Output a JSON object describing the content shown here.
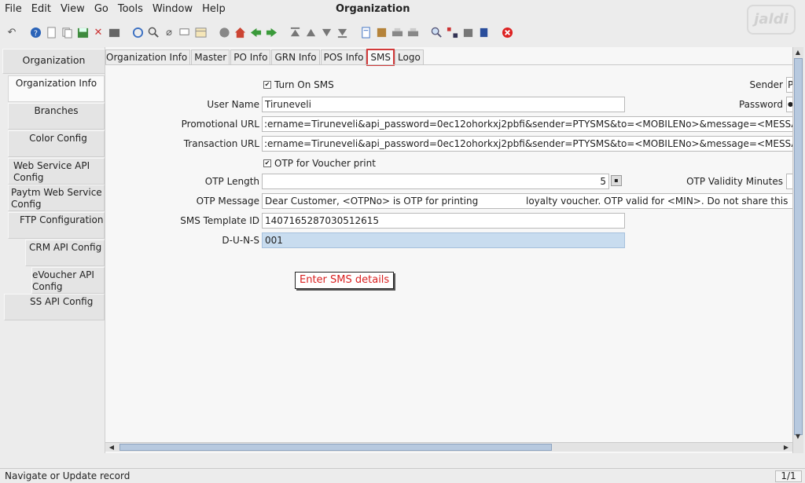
{
  "menu": {
    "file": "File",
    "edit": "Edit",
    "view": "View",
    "go": "Go",
    "tools": "Tools",
    "window": "Window",
    "help": "Help"
  },
  "window_title": "Organization",
  "brand": "jaldi",
  "icons": [
    "undo-icon",
    "help-icon",
    "new-icon",
    "copy-icon",
    "save-icon",
    "delete-icon",
    "print-icon",
    "refresh-icon",
    "zoom-icon",
    "attachment-icon",
    "chat-icon",
    "history-icon",
    "home-icon",
    "back-icon",
    "forward-icon",
    "first-icon",
    "prev-icon",
    "next-icon",
    "last-icon",
    "report-icon",
    "archive-icon",
    "print-preview-icon",
    "print-icon",
    "lookup-icon",
    "workflow-icon",
    "request-icon",
    "product-icon",
    "close-icon"
  ],
  "sidebar": {
    "items": [
      {
        "label": "Organization"
      },
      {
        "label": "Organization Info"
      },
      {
        "label": "Branches"
      },
      {
        "label": "Color Config"
      },
      {
        "label": "Web Service API Config"
      },
      {
        "label": "Paytm Web Service Config"
      },
      {
        "label": "FTP Configuration"
      },
      {
        "label": "CRM API Config"
      },
      {
        "label": "eVoucher API Config"
      },
      {
        "label": "SS API Config"
      }
    ]
  },
  "tabs": [
    "Organization Info",
    "Master",
    "PO Info",
    "GRN Info",
    "POS Info",
    "SMS",
    "Logo"
  ],
  "form": {
    "turn_on_sms": "Turn On SMS",
    "sender_label": "Sender",
    "sender_value": "P",
    "user_name_label": "User Name",
    "user_name_value": "Tiruneveli",
    "password_label": "Password",
    "password_value": "●",
    "promo_url_label": "Promotional URL",
    "promo_url_value": ":ername=Tiruneveli&api_password=0ec12ohorkxj2pbfi&sender=PTYSMS&to=<MOBILENo>&message=<MESSA",
    "trans_url_label": "Transaction URL",
    "trans_url_value": ":ername=Tiruneveli&api_password=0ec12ohorkxj2pbfi&sender=PTYSMS&to=<MOBILENo>&message=<MESSA",
    "otp_voucher": "OTP for Voucher print",
    "otp_length_label": "OTP Length",
    "otp_length_value": "5",
    "otp_validity_label": "OTP Validity Minutes",
    "otp_message_label": "OTP Message",
    "otp_message_value": "Dear Customer, <OTPNo> is OTP for printing",
    "otp_message_value2": "loyalty voucher. OTP valid for <MIN>. Do not share this",
    "sms_template_label": "SMS Template ID",
    "sms_template_value": "1407165287030512615",
    "duns_label": "D-U-N-S",
    "duns_value": "001"
  },
  "callout": "Enter SMS details",
  "status": {
    "text": "Navigate or Update record",
    "page": "1/1"
  }
}
